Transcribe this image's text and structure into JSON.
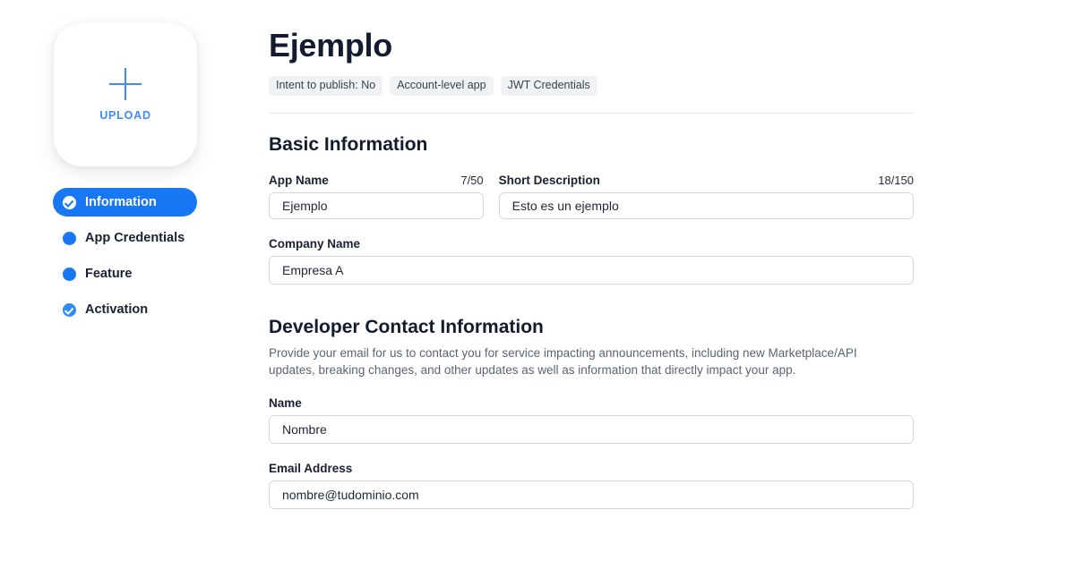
{
  "sidebar": {
    "upload": {
      "label": "UPLOAD",
      "icon": "plus-icon"
    },
    "items": [
      {
        "label": "Information",
        "icon": "check-circle-icon",
        "active": true
      },
      {
        "label": "App Credentials",
        "icon": "dot-icon",
        "active": false
      },
      {
        "label": "Feature",
        "icon": "dot-icon",
        "active": false
      },
      {
        "label": "Activation",
        "icon": "check-circle-icon",
        "active": false
      }
    ]
  },
  "header": {
    "title": "Ejemplo",
    "badges": [
      "Intent to publish: No",
      "Account-level app",
      "JWT Credentials"
    ]
  },
  "basic_information": {
    "heading": "Basic Information",
    "app_name": {
      "label": "App Name",
      "counter": "7/50",
      "value": "Ejemplo",
      "placeholder": "App Name"
    },
    "short_description": {
      "label": "Short Description",
      "counter": "18/150",
      "value": "Esto es un ejemplo",
      "placeholder": "Short Description"
    },
    "company_name": {
      "label": "Company Name",
      "value": "Empresa A",
      "placeholder": "Company Name"
    }
  },
  "developer_contact": {
    "heading": "Developer Contact Information",
    "description": "Provide your email for us to contact you for service impacting announcements, including new Marketplace/API updates, breaking changes, and other updates as well as information that directly impact your app.",
    "name": {
      "label": "Name",
      "value": "Nombre",
      "placeholder": "Name"
    },
    "email": {
      "label": "Email Address",
      "value": "nombre@tudominio.com",
      "placeholder": "Email Address"
    }
  },
  "colors": {
    "accent": "#1877f2",
    "upload_accent": "#3d8bfd",
    "badge_bg": "#f1f2f4",
    "border": "#d5d8df",
    "divider": "#e9eaee",
    "text": "#1b2033",
    "muted_text": "#5b6375"
  }
}
